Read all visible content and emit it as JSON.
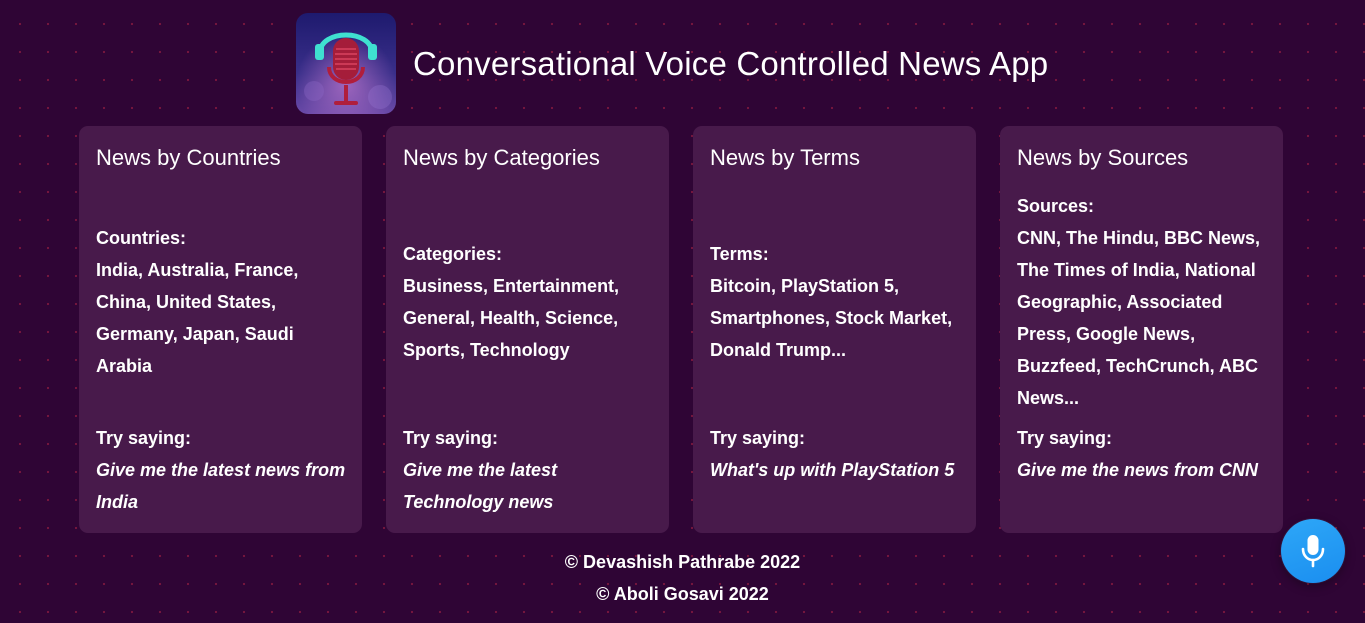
{
  "header": {
    "title": "Conversational Voice Controlled News App",
    "logo_icon": "podcast-microphone-headphones-icon"
  },
  "cards": [
    {
      "title": "News by Countries",
      "info_heading": "Countries:",
      "info_list": "India, Australia, France, China, United States, Germany, Japan, Saudi Arabia",
      "try_label": "Try saying:",
      "try_example": "Give me the latest news from India"
    },
    {
      "title": "News by Categories",
      "info_heading": "Categories:",
      "info_list": "Business, Entertainment, General, Health, Science, Sports, Technology",
      "try_label": "Try saying:",
      "try_example": "Give me the latest Technology news"
    },
    {
      "title": "News by Terms",
      "info_heading": "Terms:",
      "info_list": "Bitcoin, PlayStation 5, Smartphones, Stock Market, Donald Trump...",
      "try_label": "Try saying:",
      "try_example": "What's up with PlayStation 5"
    },
    {
      "title": "News by Sources",
      "info_heading": "Sources:",
      "info_list": "CNN, The Hindu, BBC News, The Times of India, National Geographic, Associated Press, Google News, Buzzfeed, TechCrunch, ABC News...",
      "try_label": "Try saying:",
      "try_example": "Give me the news from CNN"
    }
  ],
  "footer": {
    "line1": "© Devashish Pathrabe 2022",
    "line2": "© Aboli Gosavi 2022"
  },
  "mic_button": {
    "icon": "microphone-icon"
  },
  "colors": {
    "background": "#2f0535",
    "card": "#481a4b",
    "text": "#ffffff",
    "mic_button": "#1e96f3",
    "dots": "#be2846"
  }
}
